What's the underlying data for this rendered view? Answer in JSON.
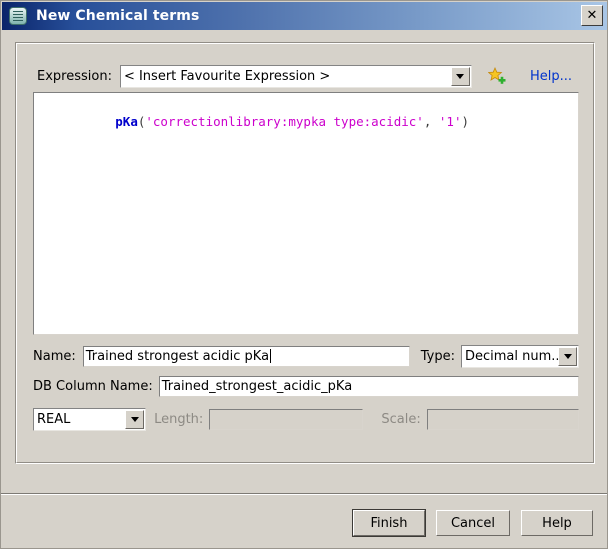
{
  "window": {
    "title": "New Chemical terms",
    "icon": "document-lines-icon",
    "close_label": "✕"
  },
  "expression_section": {
    "label": "Expression:",
    "favourite_combo": {
      "value": "< Insert Favourite Expression >",
      "arrow_icon": "chevron-down-icon"
    },
    "add_favourite_icon": "star-plus-icon",
    "help_link": "Help...",
    "editor": {
      "tokens": [
        {
          "text": "pKa",
          "type": "fn"
        },
        {
          "text": "(",
          "type": "punc"
        },
        {
          "text": "'correctionlibrary:mypka type:acidic'",
          "type": "str"
        },
        {
          "text": ", ",
          "type": "punc"
        },
        {
          "text": "'1'",
          "type": "str"
        },
        {
          "text": ")",
          "type": "punc"
        }
      ],
      "plain_text": "pKa('correctionlibrary:mypka type:acidic', '1')"
    }
  },
  "fields": {
    "name_label": "Name:",
    "name_value": "Trained strongest acidic pKa",
    "type_label": "Type:",
    "type_value": "Decimal num...",
    "db_column_label": "DB Column Name:",
    "db_column_value": "Trained_strongest_acidic_pKa",
    "sql_type_value": "REAL",
    "length_label": "Length:",
    "length_value": "",
    "scale_label": "Scale:",
    "scale_value": ""
  },
  "footer": {
    "finish_label": "Finish",
    "cancel_label": "Cancel",
    "help_label": "Help"
  },
  "colors": {
    "title_start": "#0a246a",
    "title_end": "#a9c6e6",
    "dialog_bg": "#d6d2ca",
    "link": "#0033cc",
    "code_function": "#0000cc",
    "code_string": "#cc00cc",
    "disabled_text": "#8d8a84"
  }
}
